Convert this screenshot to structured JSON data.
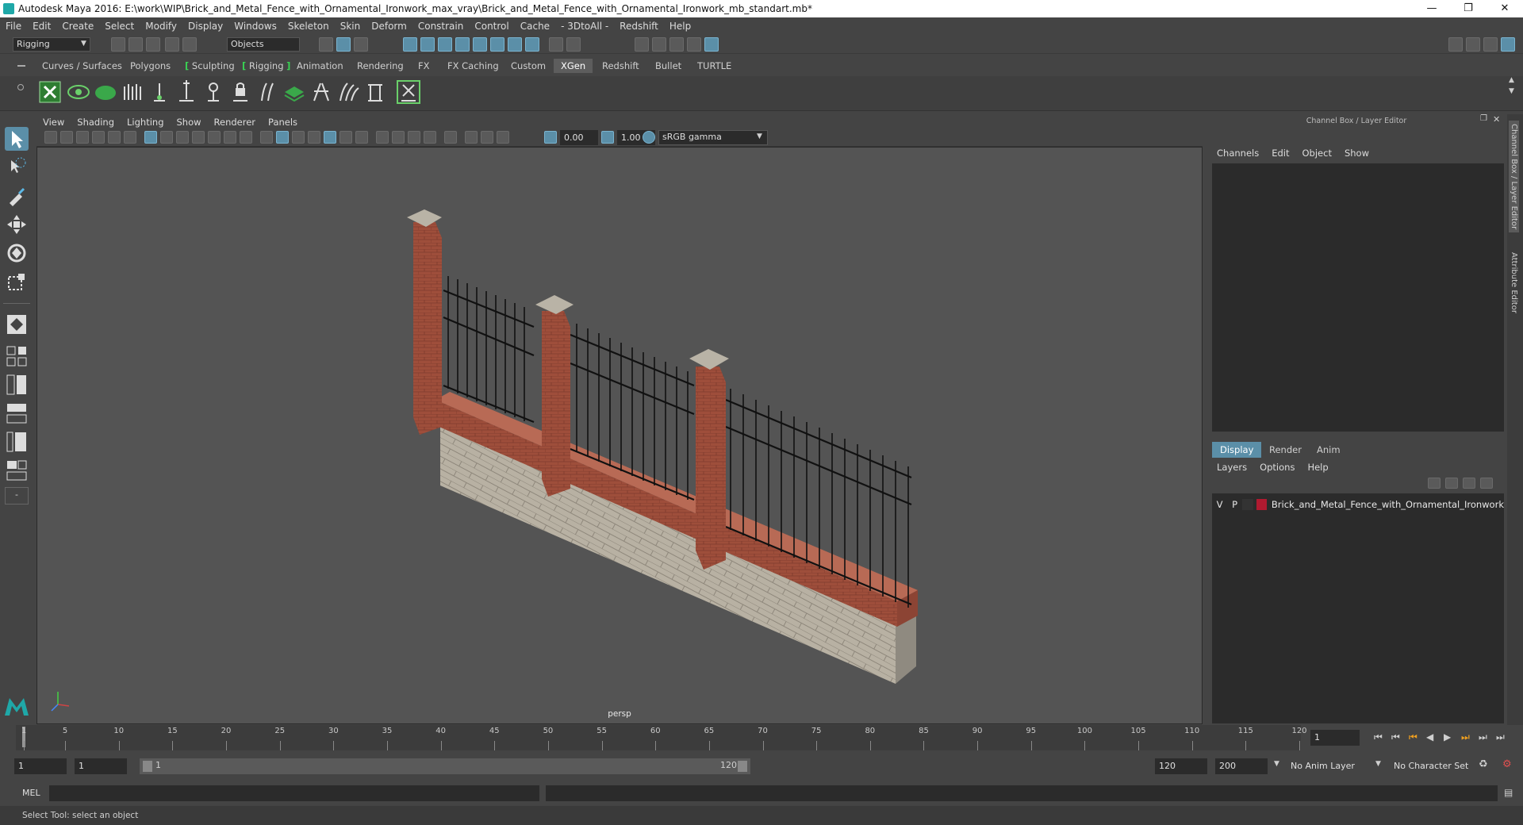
{
  "window": {
    "title": "Autodesk Maya 2016: E:\\work\\WIP\\Brick_and_Metal_Fence_with_Ornamental_Ironwork_max_vray\\Brick_and_Metal_Fence_with_Ornamental_Ironwork_mb_standart.mb*"
  },
  "menubar": [
    "File",
    "Edit",
    "Create",
    "Select",
    "Modify",
    "Display",
    "Windows",
    "Skeleton",
    "Skin",
    "Deform",
    "Constrain",
    "Control",
    "Cache",
    "- 3DtoAll -",
    "Redshift",
    "Help"
  ],
  "statusline": {
    "menuset": "Rigging",
    "selection_mode": "Objects"
  },
  "shelf_tabs": [
    "Curves / Surfaces",
    "Polygons",
    "Sculpting",
    "Rigging",
    "Animation",
    "Rendering",
    "FX",
    "FX Caching",
    "Custom",
    "XGen",
    "Redshift",
    "Bullet",
    "TURTLE"
  ],
  "shelf_active": "XGen",
  "viewport": {
    "menu": [
      "View",
      "Shading",
      "Lighting",
      "Show",
      "Renderer",
      "Panels"
    ],
    "exposure": "0.00",
    "gamma": "1.00",
    "color_space": "sRGB gamma",
    "camera": "persp"
  },
  "right_panel": {
    "title": "Channel Box / Layer Editor",
    "channel_menu": [
      "Channels",
      "Edit",
      "Object",
      "Show"
    ],
    "layer_tabs": [
      "Display",
      "Render",
      "Anim"
    ],
    "layer_active": "Display",
    "layer_menu": [
      "Layers",
      "Options",
      "Help"
    ],
    "layers": [
      {
        "v": "V",
        "p": "P",
        "name": "Brick_and_Metal_Fence_with_Ornamental_Ironwork",
        "color": "#b01a30"
      }
    ],
    "side_tabs": [
      "Channel Box / Layer Editor",
      "Attribute Editor"
    ]
  },
  "timeline": {
    "ticks": [
      "1",
      "5",
      "10",
      "15",
      "20",
      "25",
      "30",
      "35",
      "40",
      "45",
      "50",
      "55",
      "60",
      "65",
      "70",
      "75",
      "80",
      "85",
      "90",
      "95",
      "100",
      "105",
      "110",
      "115",
      "120"
    ],
    "current_frame": "1"
  },
  "range": {
    "start": "1",
    "playback_start": "1",
    "slider_start": "1",
    "slider_end": "120",
    "playback_end": "120",
    "end": "200",
    "anim_layer": "No Anim Layer",
    "character_set": "No Character Set"
  },
  "cmdline": {
    "label": "MEL"
  },
  "helpline": {
    "text": "Select Tool: select an object"
  }
}
